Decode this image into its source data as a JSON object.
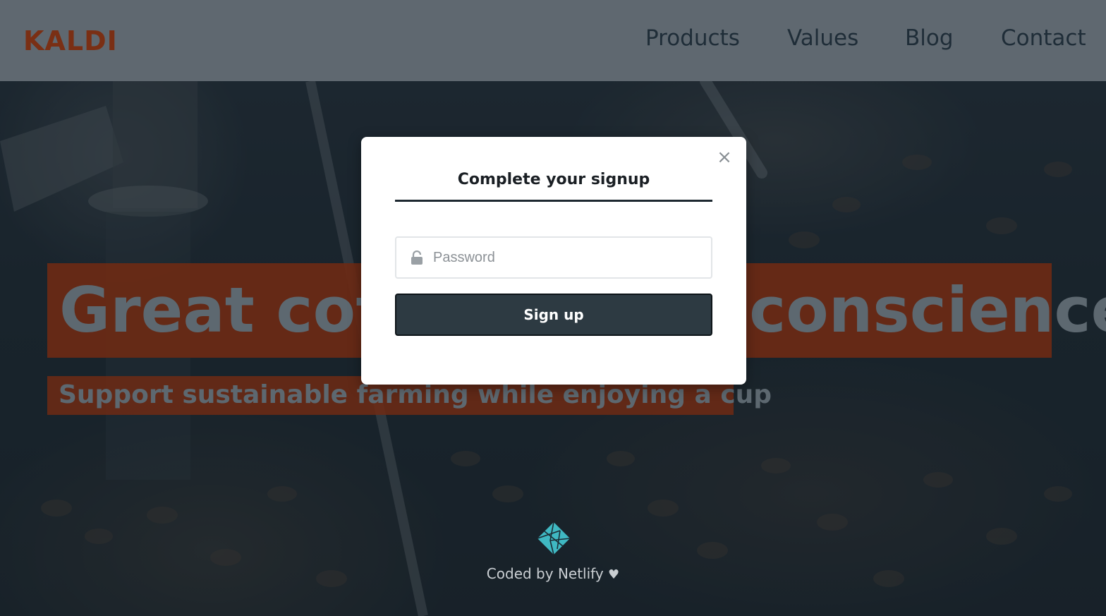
{
  "navbar": {
    "logo": "KALDI",
    "items": [
      {
        "label": "Products"
      },
      {
        "label": "Values"
      },
      {
        "label": "Blog"
      },
      {
        "label": "Contact"
      }
    ]
  },
  "hero": {
    "title": "Great coffee with a conscience",
    "subtitle": "Support sustainable farming while enjoying a cup"
  },
  "modal": {
    "title": "Complete your signup",
    "close_icon": "close-icon",
    "password_placeholder": "Password",
    "password_icon": "lock-icon",
    "submit_label": "Sign up"
  },
  "footer": {
    "text": "Coded by Netlify",
    "heart": "♥",
    "logo_icon": "netlify-logo-icon"
  },
  "colors": {
    "navbar_bg": "#5f6870",
    "logo": "#7a2f14",
    "hero_box": "#6e2a14",
    "button_bg": "#2d3a42",
    "netlify_teal": "#3fb8c2"
  }
}
